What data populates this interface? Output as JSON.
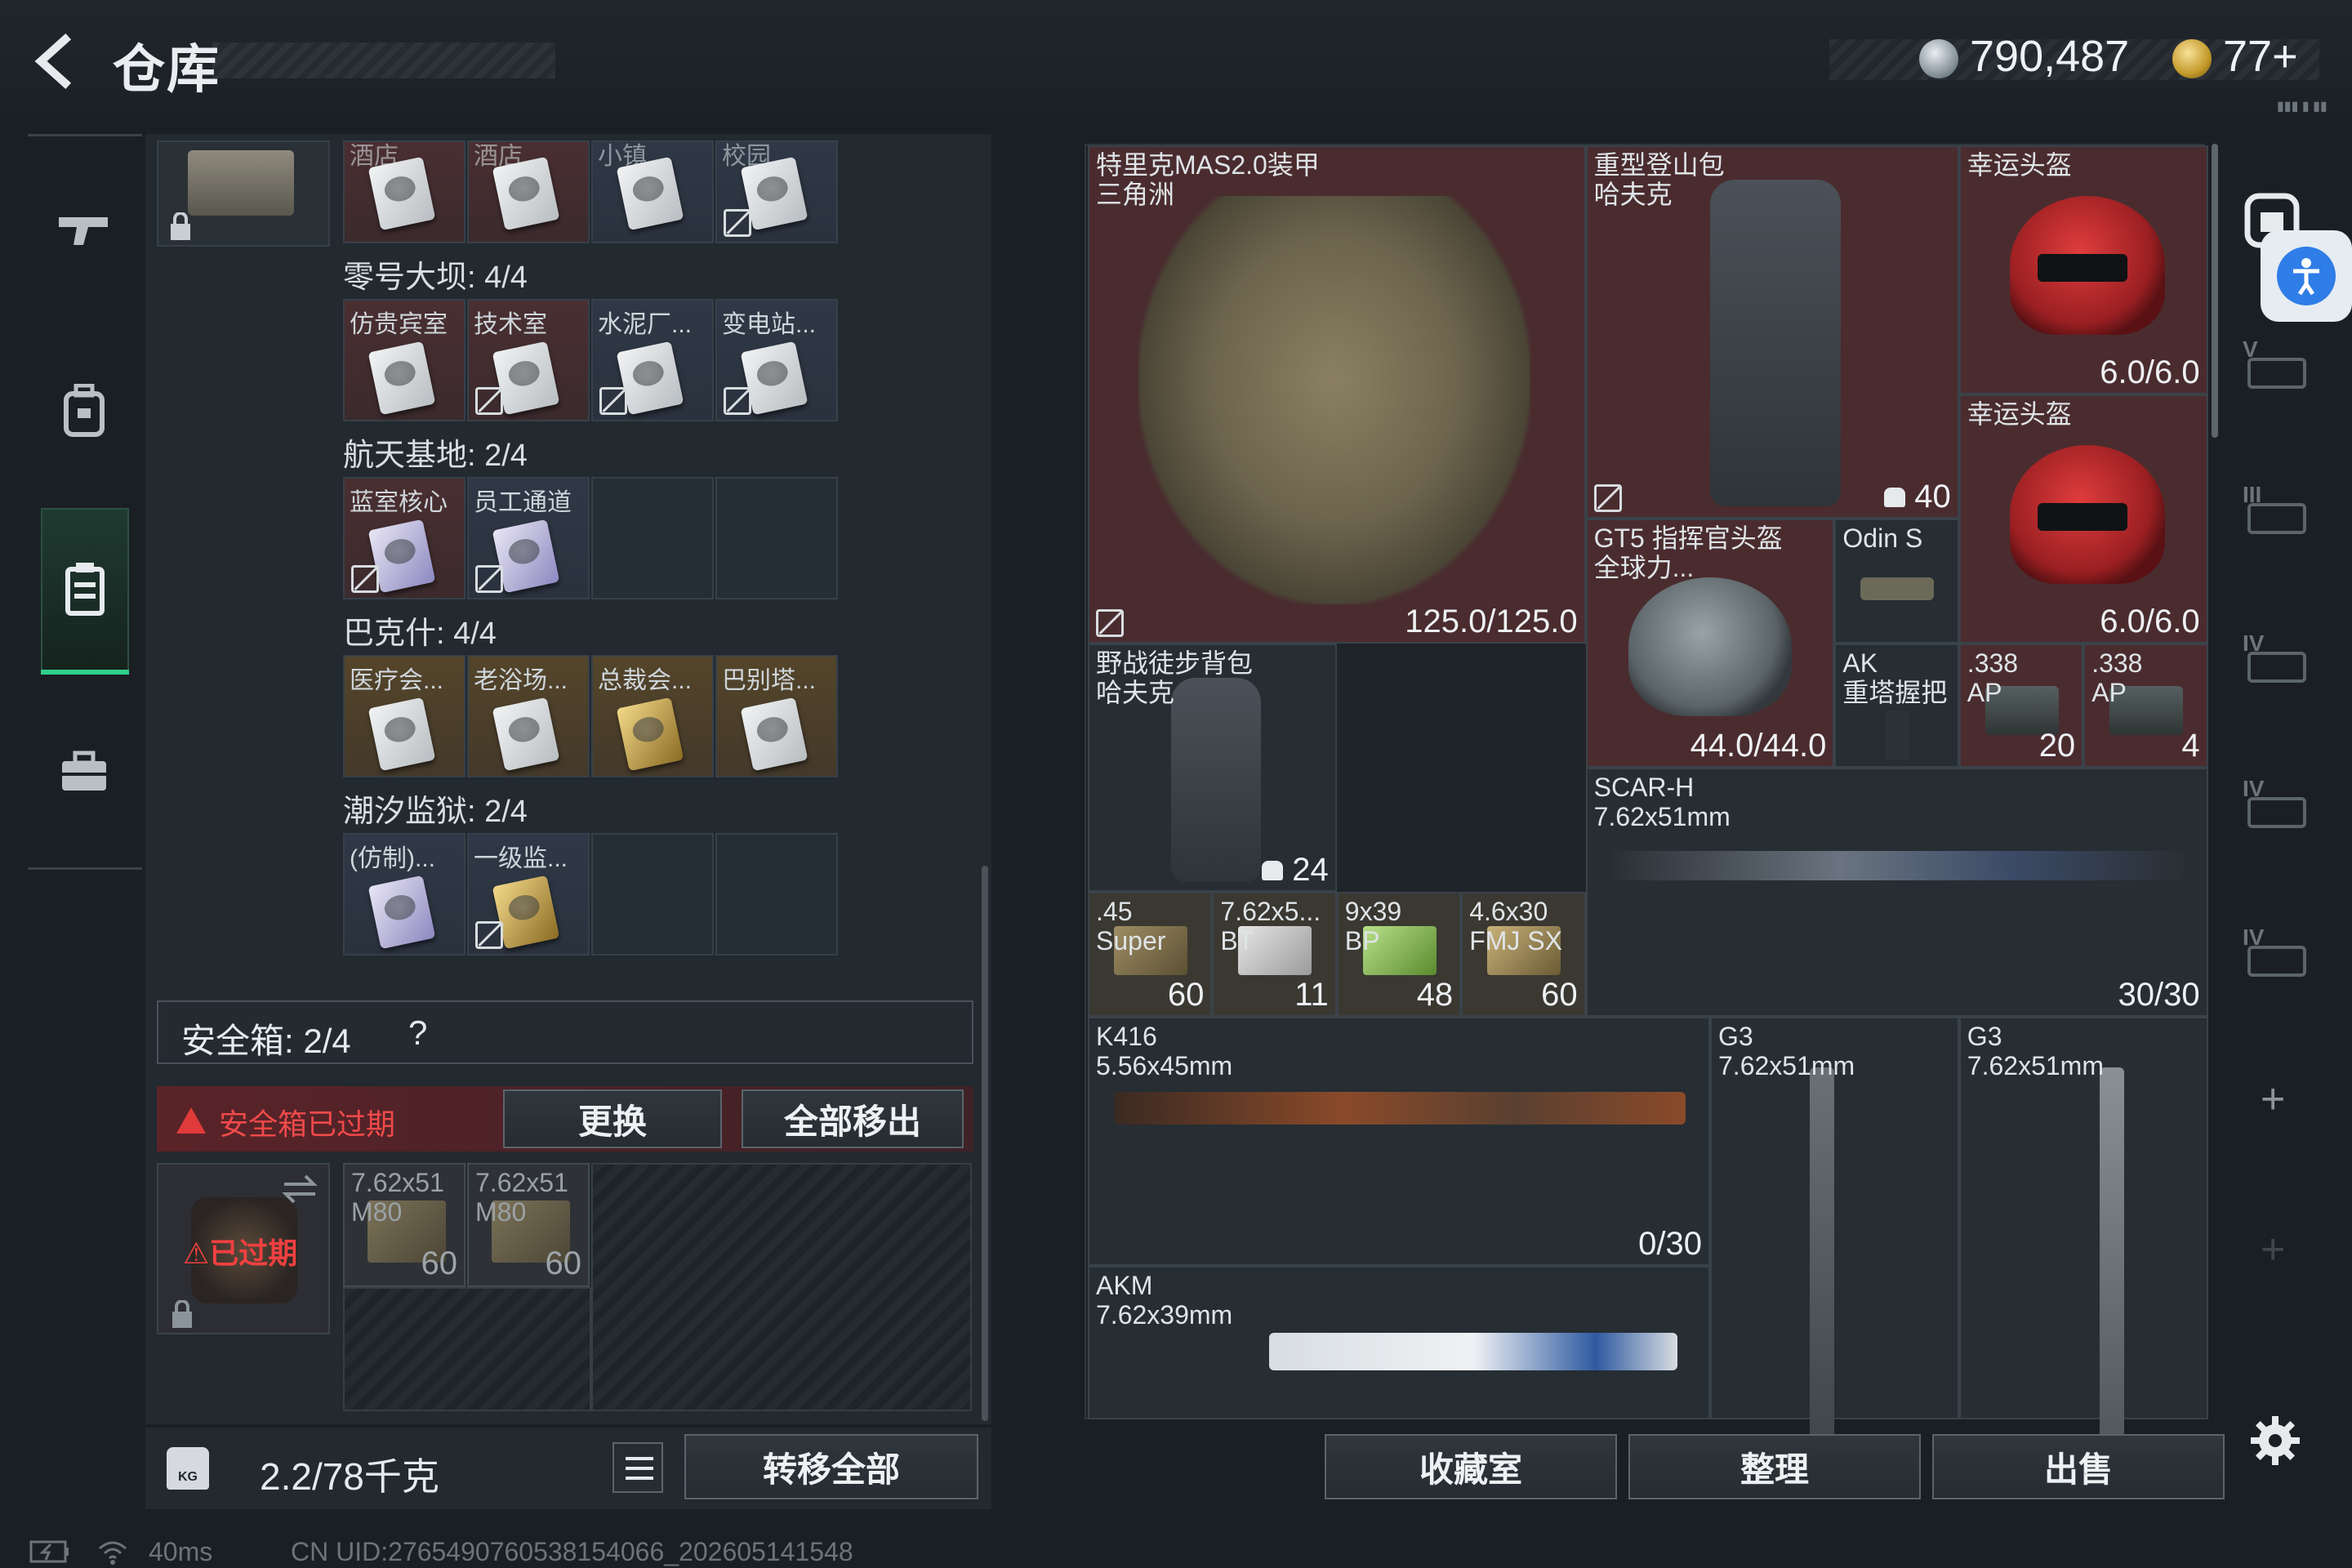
{
  "header": {
    "title": "仓库",
    "currency1": "790,487",
    "currency2": "77+",
    "currency_sub": "▮▮▮ ▮ ▮▮"
  },
  "left_panel": {
    "top_row_labels": [
      "酒店...",
      "酒店...",
      "小镇...",
      "校园..."
    ],
    "maps": [
      {
        "name": "零号大坝: 4/4",
        "cards": [
          {
            "label": "仿贵宾室",
            "style": "red",
            "card": "white",
            "locked": false
          },
          {
            "label": "技术室",
            "style": "red",
            "card": "white",
            "locked": true
          },
          {
            "label": "水泥厂...",
            "style": "blue",
            "card": "white",
            "locked": true
          },
          {
            "label": "变电站...",
            "style": "blue",
            "card": "white",
            "locked": true
          }
        ]
      },
      {
        "name": "航天基地: 2/4",
        "cards": [
          {
            "label": "蓝室核心",
            "style": "red",
            "card": "purple",
            "locked": true
          },
          {
            "label": "员工通道",
            "style": "blue",
            "card": "purple",
            "locked": true
          },
          {
            "label": "",
            "style": "empty",
            "card": "",
            "locked": false
          },
          {
            "label": "",
            "style": "empty",
            "card": "",
            "locked": false
          }
        ]
      },
      {
        "name": "巴克什: 4/4",
        "cards": [
          {
            "label": "医疗会...",
            "style": "gold",
            "card": "white",
            "locked": false
          },
          {
            "label": "老浴场...",
            "style": "gold",
            "card": "white",
            "locked": false
          },
          {
            "label": "总裁会...",
            "style": "gold",
            "card": "gold",
            "locked": false
          },
          {
            "label": "巴别塔...",
            "style": "gold",
            "card": "white",
            "locked": false
          }
        ]
      },
      {
        "name": "潮汐监狱: 2/4",
        "cards": [
          {
            "label": "(仿制)...",
            "style": "blue",
            "card": "purple",
            "locked": false
          },
          {
            "label": "一级监...",
            "style": "blue",
            "card": "gold",
            "locked": true
          },
          {
            "label": "",
            "style": "empty",
            "card": "",
            "locked": false
          },
          {
            "label": "",
            "style": "empty",
            "card": "",
            "locked": false
          }
        ]
      }
    ],
    "safebox_label": "安全箱: 2/4",
    "safebox_help": "?",
    "warning_text": "安全箱已过期",
    "replace_button": "更换",
    "remove_all_button": "全部移出",
    "expired_label": "已过期",
    "safe_items": [
      {
        "label": "7.62x51\nM80",
        "count": "60"
      },
      {
        "label": "7.62x51\nM80",
        "count": "60"
      }
    ],
    "weight": "2.2/78千克",
    "kg_label": "KG",
    "transfer_all_button": "转移全部"
  },
  "grid_items": [
    {
      "id": "vest",
      "name": "特里克MAS2.0装甲\n三角洲",
      "value": "125.0/125.0"
    },
    {
      "id": "bag",
      "name": "重型登山包\n哈夫克",
      "value": "40"
    },
    {
      "id": "helm1",
      "name": "幸运头盔",
      "value": "6.0/6.0"
    },
    {
      "id": "helm2",
      "name": "幸运头盔",
      "value": "6.0/6.0"
    },
    {
      "id": "gt5",
      "name": "GT5 指挥官头盔\n全球力...",
      "value": "44.0/44.0"
    },
    {
      "id": "odin",
      "name": "Odin S",
      "value": ""
    },
    {
      "id": "akgrip",
      "name": "AK\n重塔握把",
      "value": ""
    },
    {
      "id": "ap1",
      "name": ".338\nAP",
      "value": "20"
    },
    {
      "id": "ap2",
      "name": ".338\nAP",
      "value": "4"
    },
    {
      "id": "fbag",
      "name": "野战徒步背包\n哈夫克",
      "value": "24"
    },
    {
      "id": "scar",
      "name": "SCAR-H\n7.62x51mm",
      "value": "30/30"
    },
    {
      "id": "a45",
      "name": ".45\nSuper",
      "value": "60"
    },
    {
      "id": "a762",
      "name": "7.62x5...\nBT",
      "value": "11"
    },
    {
      "id": "a939",
      "name": "9x39\nBP",
      "value": "48"
    },
    {
      "id": "a46",
      "name": "4.6x30\nFMJ SX",
      "value": "60"
    },
    {
      "id": "k416",
      "name": "K416\n5.56x45mm",
      "value": "0/30"
    },
    {
      "id": "g3a",
      "name": "G3\n7.62x51mm",
      "value": ""
    },
    {
      "id": "g3b",
      "name": "G3\n7.62x51mm",
      "value": ""
    },
    {
      "id": "akm",
      "name": "AKM\n7.62x39mm",
      "value": ""
    }
  ],
  "side_tabs": [
    "V",
    "III",
    "IV",
    "IV",
    "IV",
    "+",
    "+"
  ],
  "bottom_buttons": {
    "collection": "收藏室",
    "sort": "整理",
    "sell": "出售"
  },
  "status": {
    "ping": "40ms",
    "uid": "CN UID:2765490760538154066_202605141548"
  },
  "colors": {
    "accent": "#2fd08a",
    "warning": "#f04040",
    "item_red": "#4a2c2f"
  }
}
